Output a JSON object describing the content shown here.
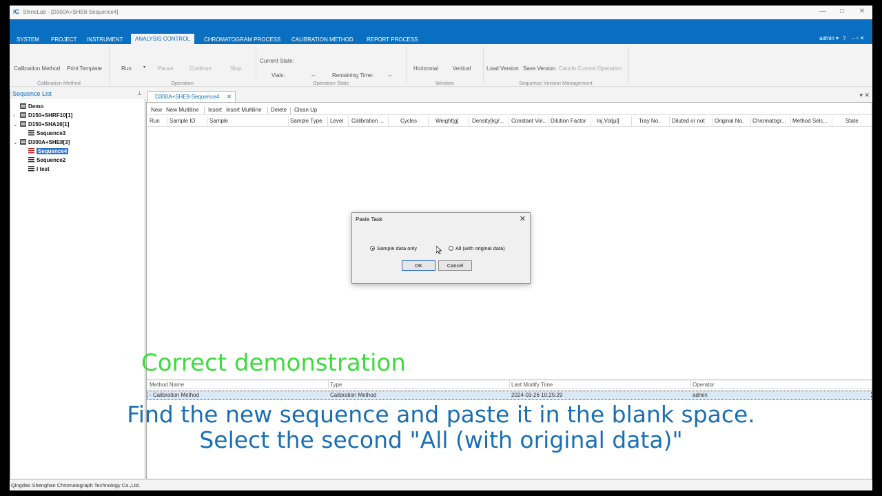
{
  "window": {
    "logo": "iC",
    "title": "ShineLab - [D300A+SHE8-Sequence4]",
    "controls": [
      "—",
      "□",
      "✕"
    ]
  },
  "menu": {
    "items": [
      "SYSTEM",
      "PROJECT",
      "INSTRUMENT",
      "ANALYSIS CONTROL",
      "CHROMATOGRAM PROCESS",
      "CALIBRATION METHOD",
      "REPORT PROCESS"
    ],
    "active": "ANALYSIS CONTROL",
    "user": "admin ▾",
    "help": "?",
    "right_controls": "‒ ▫ ✕"
  },
  "ribbon": {
    "calibration_method": {
      "btn1": "Calibration Method",
      "btn2": "Print Template",
      "label": "Calibration Method"
    },
    "operation": {
      "run": "Run",
      "pause": "Pause",
      "continue": "Continue",
      "stop": "Stop",
      "label": "Operation"
    },
    "operation_state": {
      "current_state": "Current State:",
      "vials": "Vials:",
      "vials_value": "--",
      "remaining": "Remaining Time:",
      "remaining_value": "--",
      "label": "Operation State"
    },
    "window": {
      "horizontal": "Horizontal",
      "vertical": "Vertical",
      "label": "Window"
    },
    "version": {
      "load": "Load Version",
      "save": "Save Version",
      "cancel": "Cancle Current Operation",
      "label": "Sequence Version Management"
    }
  },
  "sequence_list": {
    "title": "Sequence List",
    "pin": "ꟷ",
    "items": [
      "Demo",
      "D150+SHRF10[1]",
      "D150+SHA16[1]",
      "Sequence3",
      "D300A+SHE8[3]",
      "Sequence4",
      "Sequence2",
      "I test"
    ]
  },
  "doc_tab": {
    "label": "D300A+SHE8-Sequence4",
    "close": "✕",
    "right": "▾ ✕"
  },
  "seq_toolbar": [
    "New",
    "New Multiline",
    "Insert",
    "Insert Multiline",
    "Delete",
    "Clean Up"
  ],
  "seq_columns": [
    "Run",
    "Sample ID",
    "Sample",
    "Sample Type",
    "Level",
    "Calibration ...",
    "Cycles",
    "Weight[g]",
    "Density[kg/...",
    "Constant Vol...",
    "Dilution Factor",
    "Inj.Vol[µl]",
    "Tray No.",
    "Diluted or not",
    "Original No.",
    "Chromatogr...",
    "Method Selc...",
    "State"
  ],
  "method_table": {
    "columns": [
      "Method Name",
      "Type",
      "Last Modify Time",
      "Operator"
    ],
    "row": [
      "- Calibration Method",
      "Calibration Method",
      "2024-03-26 10:25:29",
      "admin"
    ]
  },
  "statusbar": "Qingdao Shenghan Chromatograph Technology Co.,Ltd.",
  "dialog": {
    "title": "Paste Task",
    "close": "✕",
    "option1": "Sample data only",
    "option2": "All (with original data)",
    "ok": "OK",
    "cancel": "Cancel"
  },
  "captions": {
    "green": "Correct demonstration",
    "line1": "Find the new sequence and paste it in the blank space.",
    "line2": "Select the second \"All (with original data)\""
  }
}
